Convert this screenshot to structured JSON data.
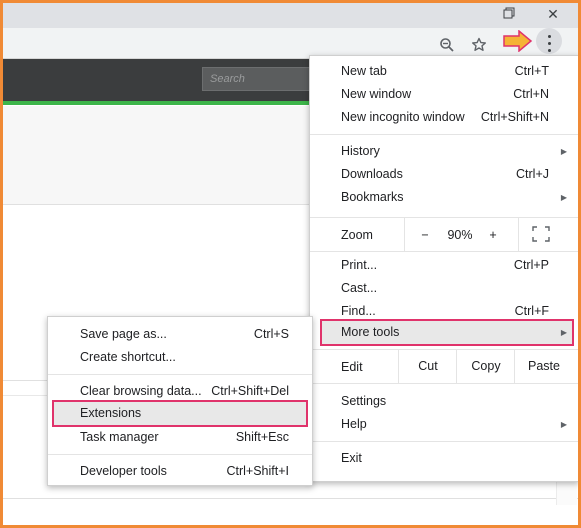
{
  "window": {
    "maximize_icon": "restore-icon",
    "close_label": "✕"
  },
  "toolbar": {
    "zoom_icon": "zoom-icon",
    "star_icon": "star-icon",
    "menu_icon": "three-dots-icon"
  },
  "page": {
    "search_placeholder": "Search"
  },
  "main_menu": {
    "new_tab": "New tab",
    "new_tab_sc": "Ctrl+T",
    "new_window": "New window",
    "new_window_sc": "Ctrl+N",
    "new_incognito": "New incognito window",
    "new_incognito_sc": "Ctrl+Shift+N",
    "history": "History",
    "downloads": "Downloads",
    "downloads_sc": "Ctrl+J",
    "bookmarks": "Bookmarks",
    "zoom": "Zoom",
    "zoom_minus": "−",
    "zoom_value": "90%",
    "zoom_plus": "+",
    "print": "Print...",
    "print_sc": "Ctrl+P",
    "cast": "Cast...",
    "find": "Find...",
    "find_sc": "Ctrl+F",
    "more_tools": "More tools",
    "edit": "Edit",
    "cut": "Cut",
    "copy": "Copy",
    "paste": "Paste",
    "settings": "Settings",
    "help": "Help",
    "exit": "Exit"
  },
  "sub_menu": {
    "save_page": "Save page as...",
    "save_page_sc": "Ctrl+S",
    "create_shortcut": "Create shortcut...",
    "clear_browsing": "Clear browsing data...",
    "clear_browsing_sc": "Ctrl+Shift+Del",
    "extensions": "Extensions",
    "task_manager": "Task manager",
    "task_manager_sc": "Shift+Esc",
    "developer_tools": "Developer tools",
    "developer_tools_sc": "Ctrl+Shift+I"
  },
  "colors": {
    "highlight": "#e0336b",
    "frame": "#f08a35",
    "arrow": "#f5b335",
    "green": "#3db54a"
  }
}
